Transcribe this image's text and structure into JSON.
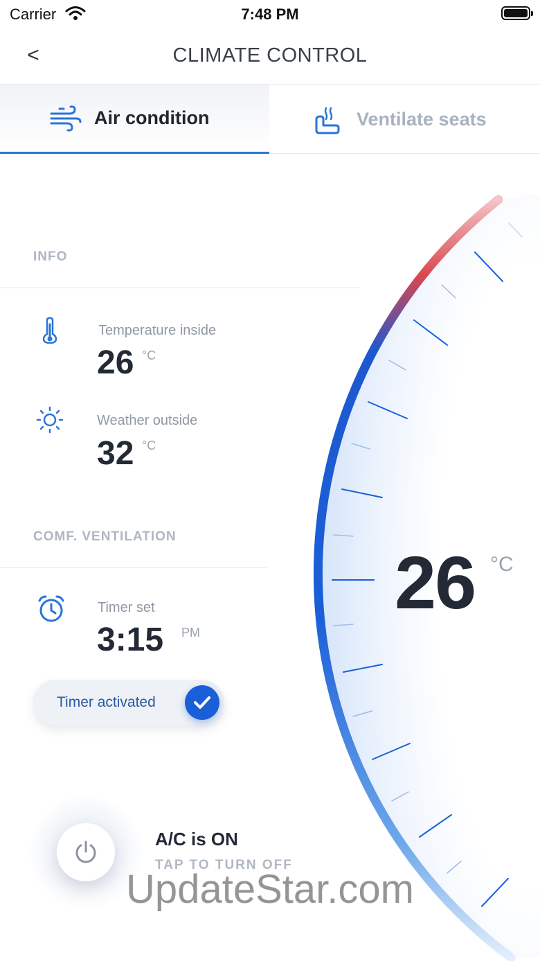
{
  "status_bar": {
    "carrier": "Carrier",
    "time": "7:48 PM"
  },
  "nav": {
    "back_label": "<",
    "title": "CLIMATE CONTROL"
  },
  "tabs": [
    {
      "label": "Air condition",
      "icon": "wind-icon",
      "selected": true
    },
    {
      "label": "Ventilate seats",
      "icon": "heated-seat-icon",
      "selected": false
    }
  ],
  "info": {
    "section_label": "INFO",
    "temperature_inside": {
      "label": "Temperature inside",
      "value": "26",
      "unit": "°C",
      "icon": "thermometer-icon"
    },
    "weather_outside": {
      "label": "Weather outside",
      "value": "32",
      "unit": "°C",
      "icon": "sun-icon"
    }
  },
  "ventilation": {
    "section_label": "COMF. VENTILATION",
    "timer": {
      "label": "Timer set",
      "value": "3:15",
      "suffix": "PM",
      "icon": "alarm-clock-icon"
    },
    "timer_toggle": {
      "label": "Timer activated",
      "checked": true
    }
  },
  "ac": {
    "status": "A/C is ON",
    "action": "TAP TO TURN OFF",
    "icon": "power-icon"
  },
  "dial": {
    "value": "26",
    "unit": "°C"
  },
  "watermark": "UpdateStar.com",
  "colors": {
    "accent": "#1a5fd8",
    "hot": "#d9474f",
    "text": "#232a36",
    "muted": "#aeb6c2"
  }
}
